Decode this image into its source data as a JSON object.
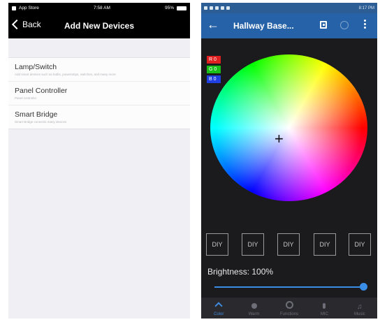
{
  "left": {
    "status": {
      "carrier": "App Store",
      "time": "7:58 AM",
      "battery": "95%"
    },
    "nav": {
      "back_label": "Back",
      "title": "Add New Devices"
    },
    "devices": [
      {
        "title": "Lamp/Switch",
        "description": "Add smart devices such as bulbs, powerstrips, switches, and many more"
      },
      {
        "title": "Panel Controller",
        "description": "Panel controller"
      },
      {
        "title": "Smart Bridge",
        "description": "Smart Bridge connects many devices"
      }
    ]
  },
  "right": {
    "toolbar": {
      "title": "Hallway Base..."
    },
    "status": {
      "time": "8:17 PM"
    },
    "rgb": {
      "r": "R 0",
      "g": "G 0",
      "b": "B 0"
    },
    "diy_buttons": [
      "DIY",
      "DIY",
      "DIY",
      "DIY",
      "DIY"
    ],
    "brightness_label": "Brightness: 100%",
    "brightness_value": 1.0,
    "tabs": [
      {
        "label": "Color",
        "icon": "color-icon",
        "active": true
      },
      {
        "label": "Warm",
        "icon": "warm-icon",
        "active": false
      },
      {
        "label": "Functions",
        "icon": "functions-icon",
        "active": false
      },
      {
        "label": "MIC",
        "icon": "mic-icon",
        "active": false
      },
      {
        "label": "Music",
        "icon": "music-icon",
        "active": false
      }
    ],
    "colors": {
      "accent": "#2662a8",
      "slider": "#3b8ee8",
      "active_tab": "#3f89dd"
    }
  }
}
